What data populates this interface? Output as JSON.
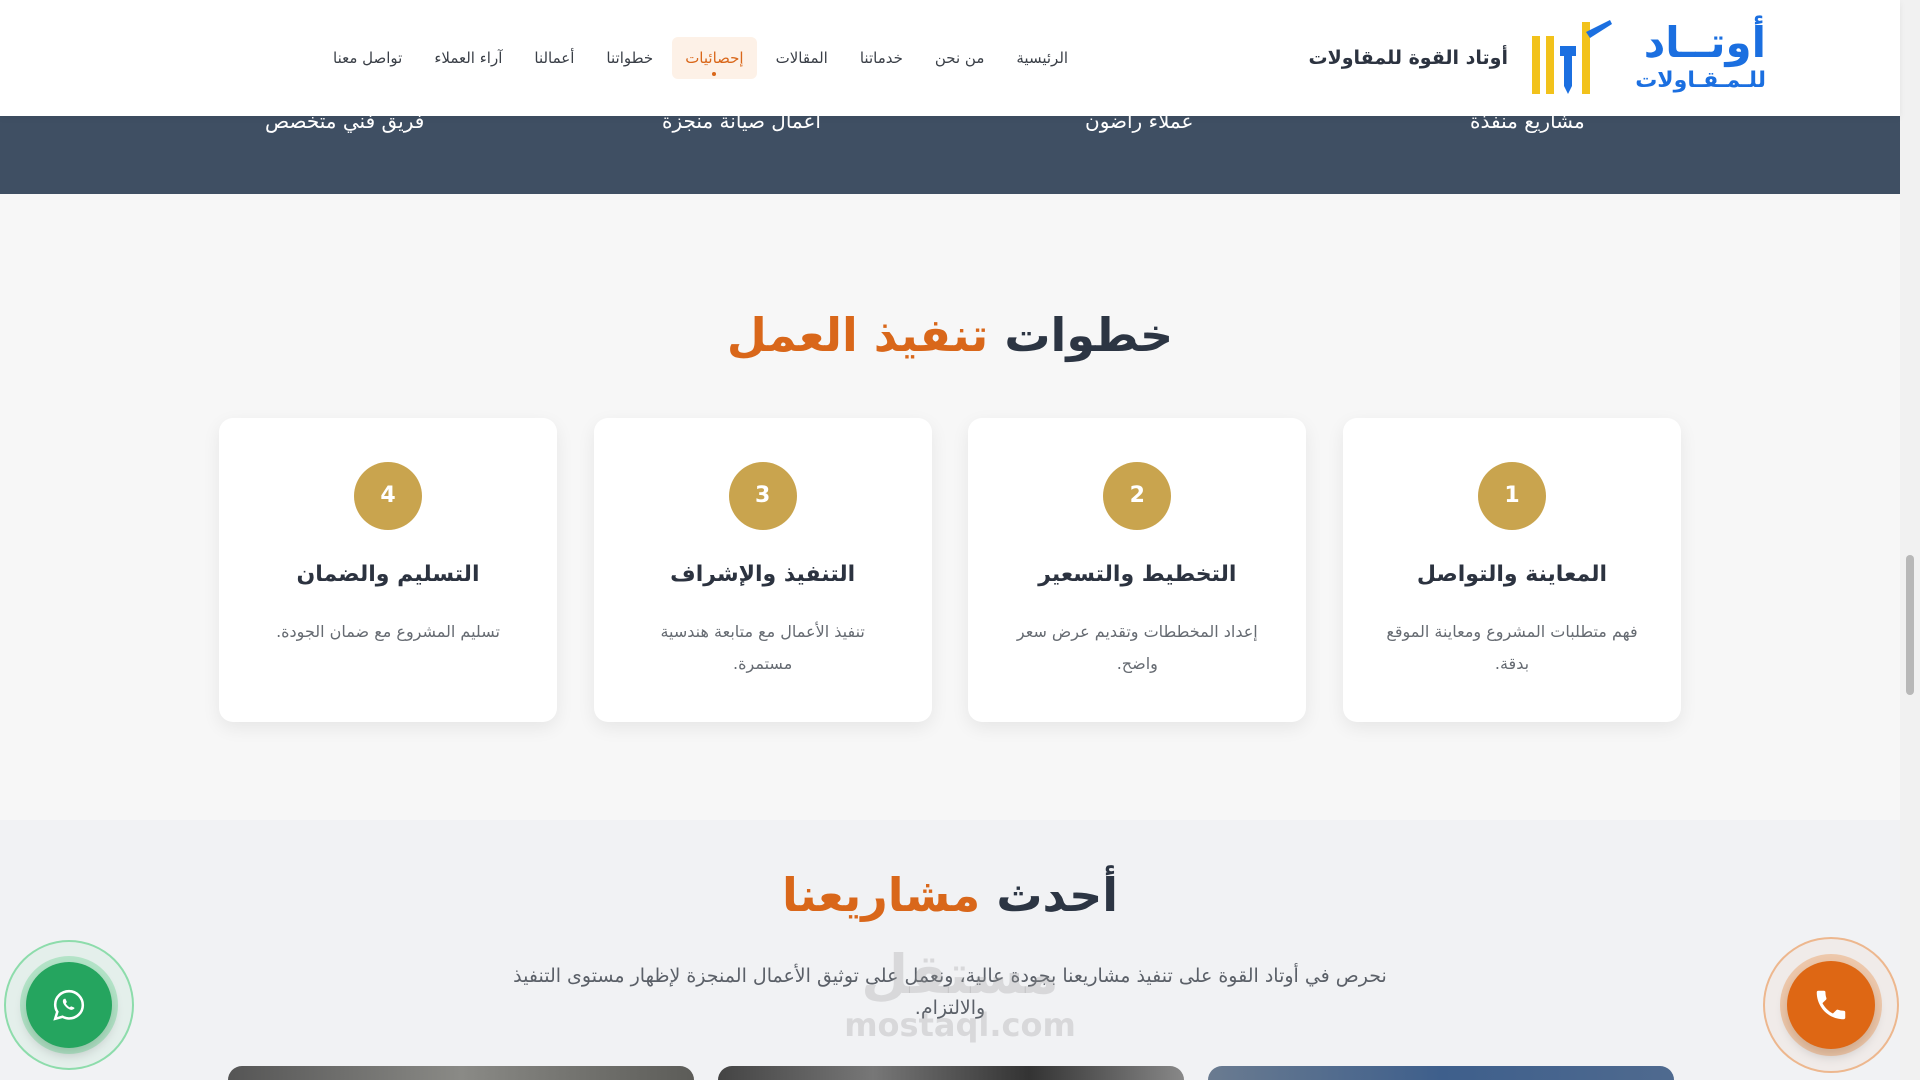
{
  "header": {
    "brand_name": "أوتاد القوة للمقاولات",
    "logo_main": "أوتــاد",
    "logo_sub": "للـمـقـاولات",
    "nav": [
      {
        "label": "الرئيسية",
        "active": false
      },
      {
        "label": "من نحن",
        "active": false
      },
      {
        "label": "خدماتنا",
        "active": false
      },
      {
        "label": "المقالات",
        "active": false
      },
      {
        "label": "إحصائيات",
        "active": true
      },
      {
        "label": "خطواتنا",
        "active": false
      },
      {
        "label": "أعمالنا",
        "active": false
      },
      {
        "label": "آراء العملاء",
        "active": false
      },
      {
        "label": "تواصل معنا",
        "active": false
      }
    ]
  },
  "stats": {
    "labels": [
      "مشاريع منفذة",
      "عملاء راضون",
      "أعمال صيانة منجزة",
      "فريق فني متخصص"
    ]
  },
  "steps": {
    "title_part1": "خطوات",
    "title_part2": "تنفيذ العمل",
    "cards": [
      {
        "number": "1",
        "title": "المعاينة والتواصل",
        "text": "فهم متطلبات المشروع ومعاينة الموقع بدقة."
      },
      {
        "number": "2",
        "title": "التخطيط والتسعير",
        "text": "إعداد المخططات وتقديم عرض سعر واضح."
      },
      {
        "number": "3",
        "title": "التنفيذ والإشراف",
        "text": "تنفيذ الأعمال مع متابعة هندسية مستمرة."
      },
      {
        "number": "4",
        "title": "التسليم والضمان",
        "text": "تسليم المشروع مع ضمان الجودة."
      }
    ]
  },
  "projects": {
    "title_part1": "أحدث",
    "title_part2": "مشاريعنا",
    "description": "نحرص في أوتاد القوة على تنفيذ مشاريعنا بجودة عالية، ونعمل على توثيق الأعمال المنجزة لإظهار مستوى التنفيذ والالتزام."
  },
  "watermark": {
    "arabic": "مستقل",
    "latin": "mostaql.com"
  },
  "colors": {
    "accent": "#d9671a",
    "gold": "#c9a44e",
    "dark_band": "#3f4f63",
    "whatsapp": "#25a55f",
    "brand_blue": "#1b6fe0"
  }
}
